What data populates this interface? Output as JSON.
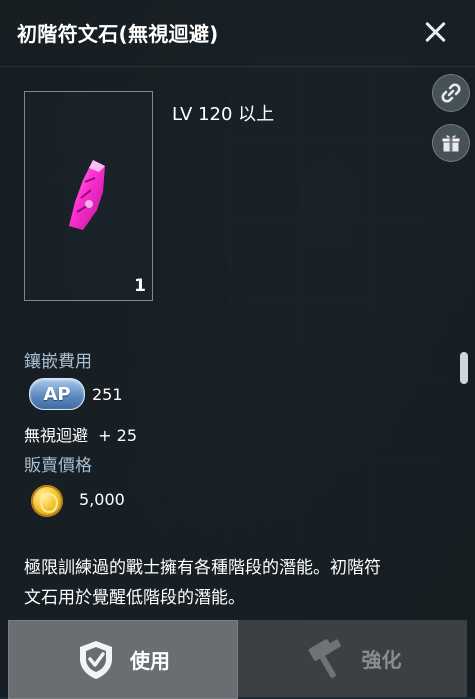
{
  "header": {
    "title": "初階符文石(無視迴避)"
  },
  "item": {
    "count": "1",
    "level_requirement": "LV 120 以上"
  },
  "inlay_cost": {
    "label": "鑲嵌費用",
    "currency_badge": "AP",
    "amount": "251"
  },
  "stat": {
    "text": "無視迴避  + 25"
  },
  "sell_price": {
    "label": "販賣價格",
    "amount": "5,000"
  },
  "description": {
    "line1": "極限訓練過的戰士擁有各種階段的潛能。初階符",
    "line2": "文石用於覺醒低階段的潛能。"
  },
  "buttons": {
    "use_label": "使用",
    "enhance_label": "強化"
  },
  "icons": {
    "close": "close-icon",
    "link": "link-icon",
    "gift": "gift-box-icon",
    "shield": "shield-check-icon",
    "hammer": "hammer-icon",
    "coin": "gold-coin-icon",
    "rune": "pink-rune-stone-icon"
  },
  "colors": {
    "label_blue": "#a9bed0",
    "rune_pink": "#ff2fd2",
    "ap_blue": "#5f8cc0",
    "coin_gold": "#f2c230"
  }
}
